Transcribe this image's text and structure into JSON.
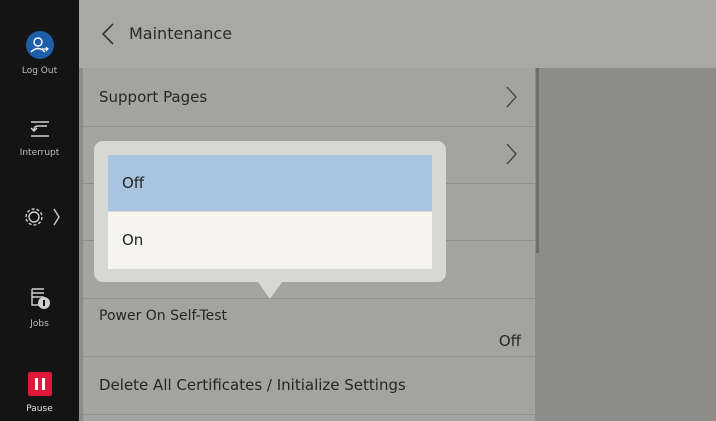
{
  "sidebar": {
    "logout_label": "Log Out",
    "interrupt_label": "Interrupt",
    "jobs_label": "Jobs",
    "pause_label": "Pause",
    "accent_color": "#e0193a"
  },
  "header": {
    "title": "Maintenance",
    "back_icon": "chevron-left-icon"
  },
  "list": {
    "items": [
      {
        "label": "Support Pages",
        "value": ""
      },
      {
        "label": "",
        "value": ""
      },
      {
        "label": "",
        "value": ""
      },
      {
        "label": "",
        "value": ""
      },
      {
        "label": "Power On Self-Test",
        "value": "Off"
      },
      {
        "label": "Delete All Certificates / Initialize Settings",
        "value": ""
      }
    ]
  },
  "popup": {
    "options": [
      {
        "label": "Off",
        "selected": true
      },
      {
        "label": "On",
        "selected": false
      }
    ]
  }
}
